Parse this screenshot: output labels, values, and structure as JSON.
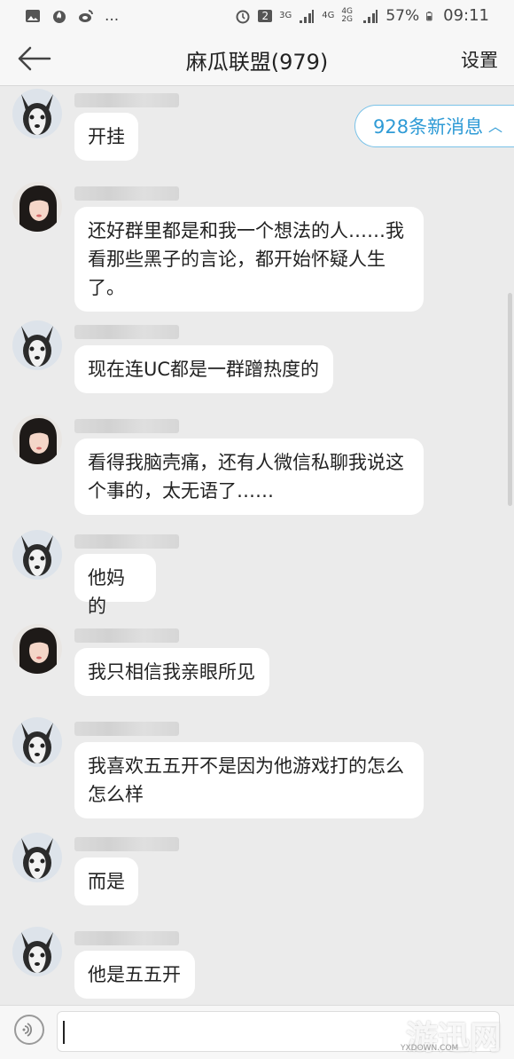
{
  "status_bar": {
    "time": "09:11",
    "battery": "57%",
    "sim_badge": "2",
    "net1": "3G",
    "net2": "4G",
    "net3": "4G 2G",
    "more": "..."
  },
  "header": {
    "title": "麻瓜联盟(979)",
    "settings_label": "设置"
  },
  "new_messages_label": "928条新消息",
  "messages": [
    {
      "avatar": "husky",
      "text": "开挂"
    },
    {
      "avatar": "girl",
      "text": "还好群里都是和我一个想法的人……我\n看那些黑子的言论，都开始怀疑人生\n了。"
    },
    {
      "avatar": "husky",
      "text": "现在连UC都是一群蹭热度的"
    },
    {
      "avatar": "girl",
      "text": "看得我脑壳痛，还有人微信私聊我说这\n个事的，太无语了……"
    },
    {
      "avatar": "husky",
      "text": "他妈的"
    },
    {
      "avatar": "girl",
      "text": "我只相信我亲眼所见"
    },
    {
      "avatar": "husky",
      "text": "我喜欢五五开不是因为他游戏打的怎么\n怎么样"
    },
    {
      "avatar": "husky",
      "text": "而是"
    },
    {
      "avatar": "husky",
      "text": "他是五五开"
    }
  ],
  "watermark": {
    "text": "游迅网",
    "sub": "YXDOWN.COM"
  },
  "icons": {
    "back": "back-arrow-icon",
    "voice": "voice-icon",
    "chevron": "chevron-up-icon"
  },
  "colors": {
    "accent": "#2f9bd6",
    "bubble": "#ffffff",
    "background": "#ebebeb"
  }
}
